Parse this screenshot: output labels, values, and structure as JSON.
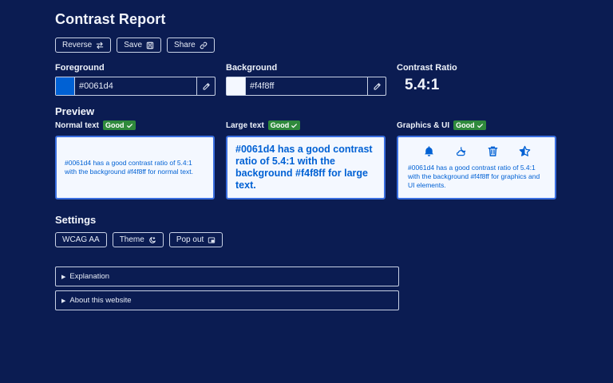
{
  "title": "Contrast Report",
  "toolbar": {
    "reverse_label": "Reverse",
    "save_label": "Save",
    "share_label": "Share"
  },
  "foreground": {
    "label": "Foreground",
    "value": "#0061d4",
    "swatch_color": "#0061d4"
  },
  "background": {
    "label": "Background",
    "value": "#f4f8ff",
    "swatch_color": "#f4f8ff"
  },
  "contrast": {
    "label": "Contrast Ratio",
    "value": "5.4:1"
  },
  "preview": {
    "heading": "Preview",
    "normal": {
      "label": "Normal text",
      "badge": "Good",
      "text": "#0061d4 has a good contrast ratio of 5.4:1 with the background #f4f8ff for normal text."
    },
    "large": {
      "label": "Large text",
      "badge": "Good",
      "text": "#0061d4 has a good contrast ratio of 5.4:1 with the background #f4f8ff for large text."
    },
    "graphics": {
      "label": "Graphics & UI",
      "badge": "Good",
      "text": "#0061d4 has a good contrast ratio of 5.4:1 with the background #f4f8ff for graphics and UI elements.",
      "icons": [
        "bell-icon",
        "cloud-moon-icon",
        "trash-icon",
        "star-half-icon"
      ]
    }
  },
  "settings": {
    "heading": "Settings",
    "wcag_label": "WCAG AA",
    "theme_label": "Theme",
    "popout_label": "Pop out"
  },
  "details": {
    "explanation": "Explanation",
    "about": "About this website"
  },
  "colors": {
    "page_bg": "#0b1c52",
    "accent": "#0061d4",
    "card_bg": "#f4f8ff",
    "good_badge": "#2f8a3c"
  }
}
